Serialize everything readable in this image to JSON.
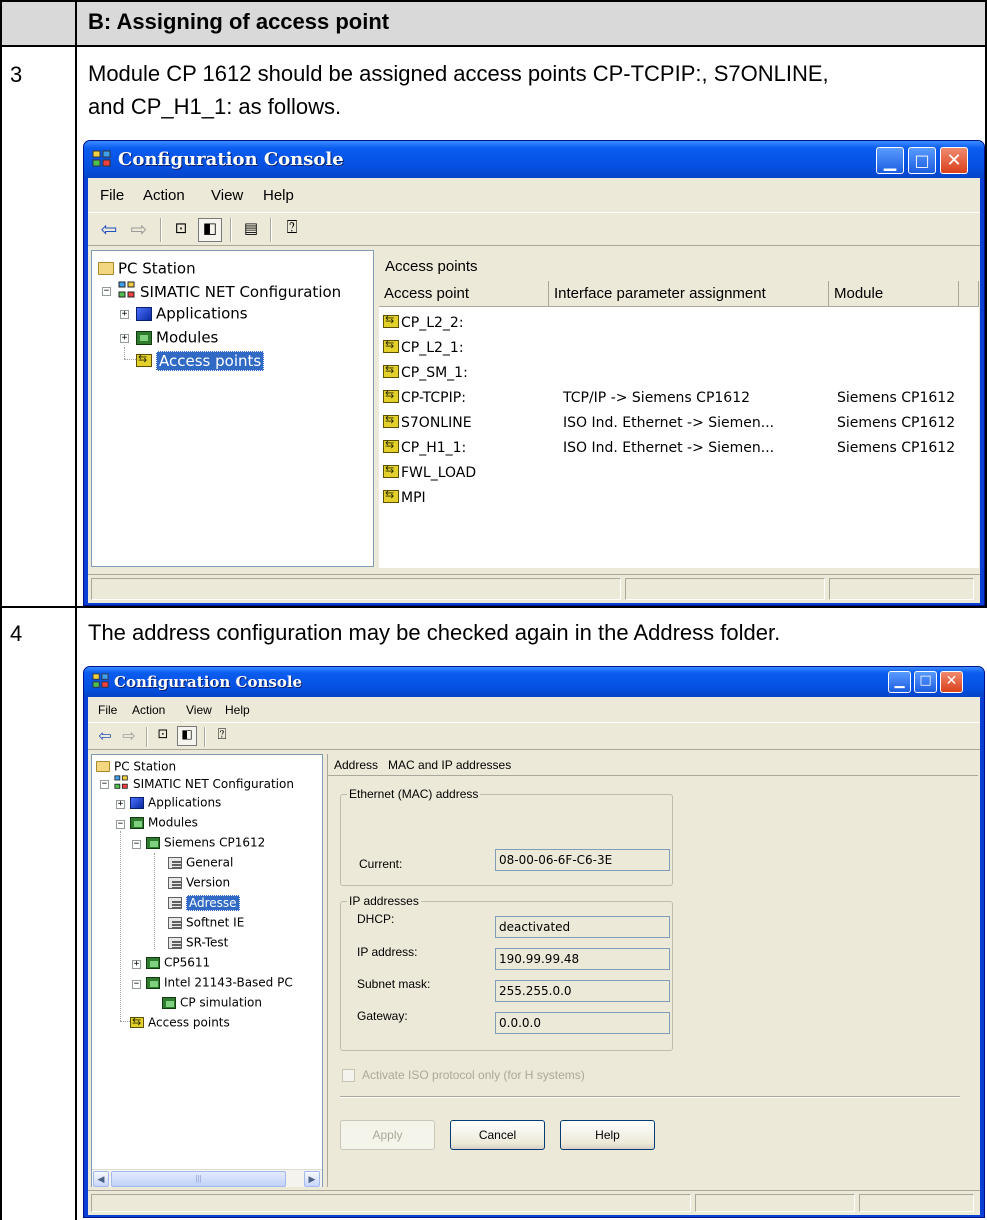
{
  "doc": {
    "header_title": "B: Assigning of access point",
    "step3": {
      "number": "3",
      "text_line1": "Module CP 1612 should be assigned access points CP-TCPIP:, S7ONLINE,",
      "text_line2": "and CP_H1_1: as follows."
    },
    "step4": {
      "number": "4",
      "text": "The address configuration may be checked again in the Address folder."
    }
  },
  "window1": {
    "title": "Configuration  Console",
    "menu": [
      "File",
      "Action",
      "View",
      "Help"
    ],
    "menu_hotkeys": [
      "F",
      "A",
      "V",
      "H"
    ],
    "tree": {
      "root": "PC Station",
      "config": "SIMATIC NET Configuration",
      "applications": "Applications",
      "modules": "Modules",
      "access_points": "Access points"
    },
    "list_title": "Access points",
    "columns": [
      "Access point",
      "Interface parameter assignment",
      "Module"
    ],
    "rows": [
      {
        "ap": "CP_L2_2:",
        "iface": "",
        "module": ""
      },
      {
        "ap": "CP_L2_1:",
        "iface": "",
        "module": ""
      },
      {
        "ap": "CP_SM_1:",
        "iface": "",
        "module": ""
      },
      {
        "ap": "CP-TCPIP:",
        "iface": "TCP/IP -> Siemens CP1612",
        "module": "Siemens CP1612"
      },
      {
        "ap": "S7ONLINE",
        "iface": "ISO Ind. Ethernet -> Siemen...",
        "module": "Siemens CP1612"
      },
      {
        "ap": "CP_H1_1:",
        "iface": "ISO Ind. Ethernet -> Siemen...",
        "module": "Siemens CP1612"
      },
      {
        "ap": "FWL_LOAD",
        "iface": "",
        "module": ""
      },
      {
        "ap": "MPI",
        "iface": "",
        "module": ""
      }
    ]
  },
  "window2": {
    "title": "Configuration  Console",
    "menu": [
      "File",
      "Action",
      "View",
      "Help"
    ],
    "tree": {
      "root": "PC Station",
      "config": "SIMATIC NET Configuration",
      "applications": "Applications",
      "modules": "Modules",
      "cp1612": "Siemens CP1612",
      "general": "General",
      "version": "Version",
      "adresse": "Adresse",
      "softnet": "Softnet IE",
      "srtest": "SR-Test",
      "cp5611": "CP5611",
      "intel": "Intel 21143-Based PC",
      "cpsim": "CP simulation",
      "access_points": "Access points"
    },
    "panel_title": "Address   MAC and IP addresses",
    "mac_group": "Ethernet (MAC) address",
    "current_label": "Current:",
    "current_value": "08-00-06-6F-C6-3E",
    "ip_group": "IP addresses",
    "dhcp_label": "DHCP:",
    "dhcp_value": "deactivated",
    "ip_label": "IP address:",
    "ip_value": "190.99.99.48",
    "mask_label": "Subnet mask:",
    "mask_value": "255.255.0.0",
    "gw_label": "Gateway:",
    "gw_value": "0.0.0.0",
    "iso_checkbox": "Activate ISO protocol only (for H systems)",
    "apply": "Apply",
    "cancel": "Cancel",
    "help": "Help"
  }
}
